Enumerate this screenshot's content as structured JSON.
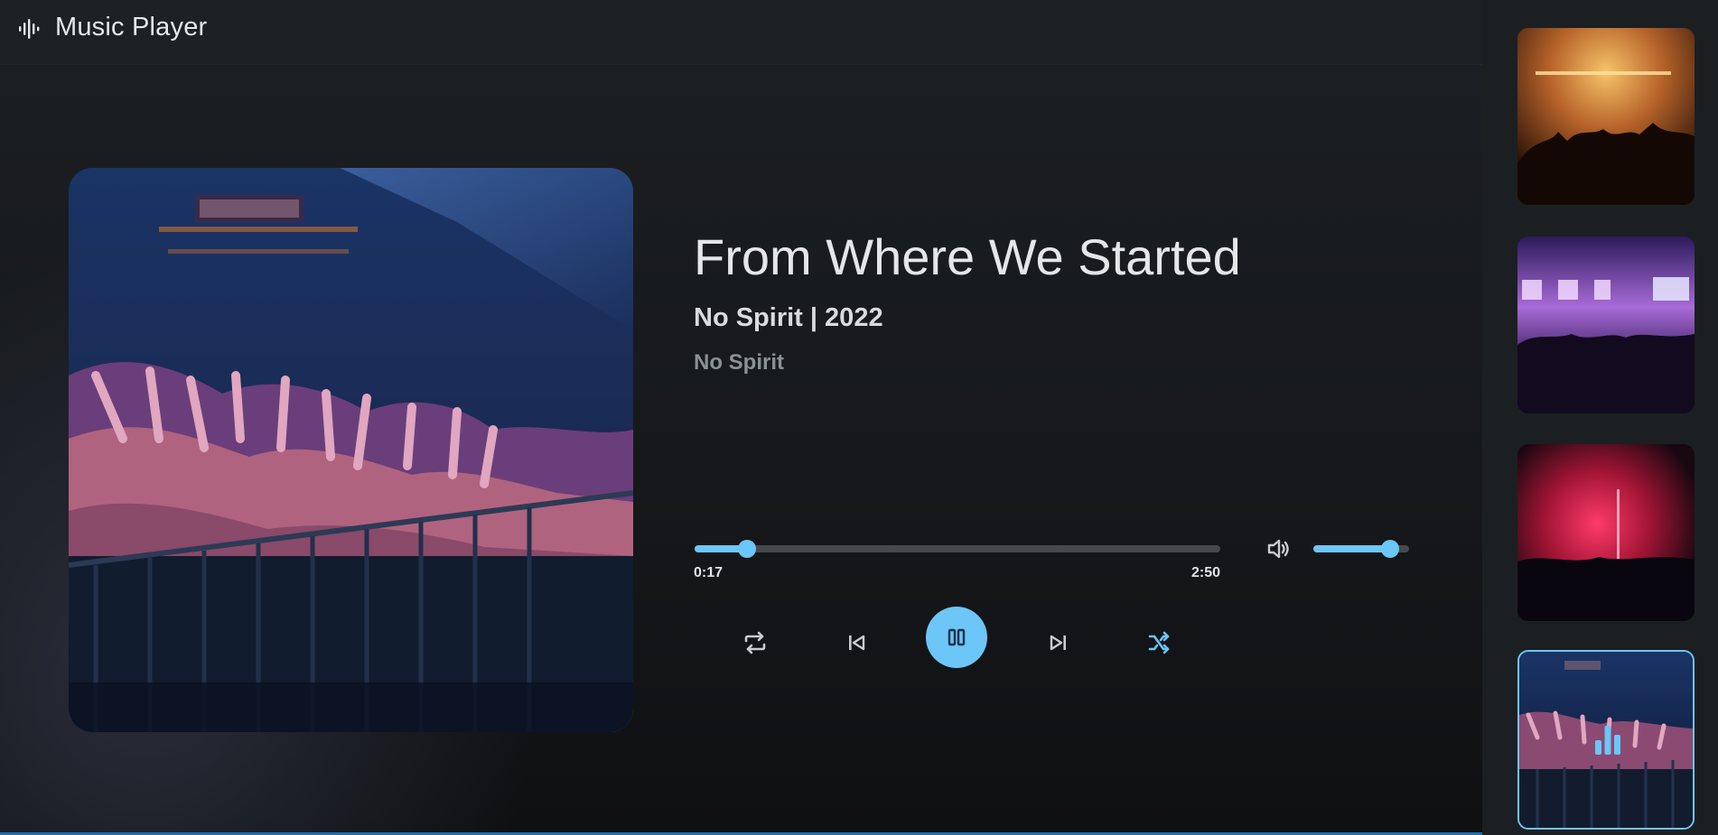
{
  "header": {
    "logo_icon": "audio-waveform-icon",
    "title": "Music Player"
  },
  "track": {
    "title": "From Where We Started",
    "meta": "No Spirit | 2022",
    "artist": "No Spirit",
    "artwork": "concert-crowd-image"
  },
  "progress": {
    "current_time": "0:17",
    "total_time": "2:50",
    "fraction": 0.1
  },
  "volume": {
    "icon": "speaker-volume-icon",
    "fraction": 0.8
  },
  "controls": {
    "repeat_icon": "repeat-icon",
    "prev_icon": "skip-previous-icon",
    "play_pause_icon": "pause-icon",
    "next_icon": "skip-next-icon",
    "shuffle_icon": "shuffle-icon"
  },
  "playlist": {
    "items": [
      {
        "image": "concert-stage-orange-image",
        "active": false
      },
      {
        "image": "concert-stage-purple-image",
        "active": false
      },
      {
        "image": "concert-stage-red-image",
        "active": false
      },
      {
        "image": "concert-crowd-image",
        "active": true,
        "indicator": "now-playing-bars-icon"
      }
    ]
  },
  "colors": {
    "accent": "#6cc6f7",
    "background": "#1b1e22",
    "sidebar": "#1c1f22",
    "track": "#45484c"
  }
}
